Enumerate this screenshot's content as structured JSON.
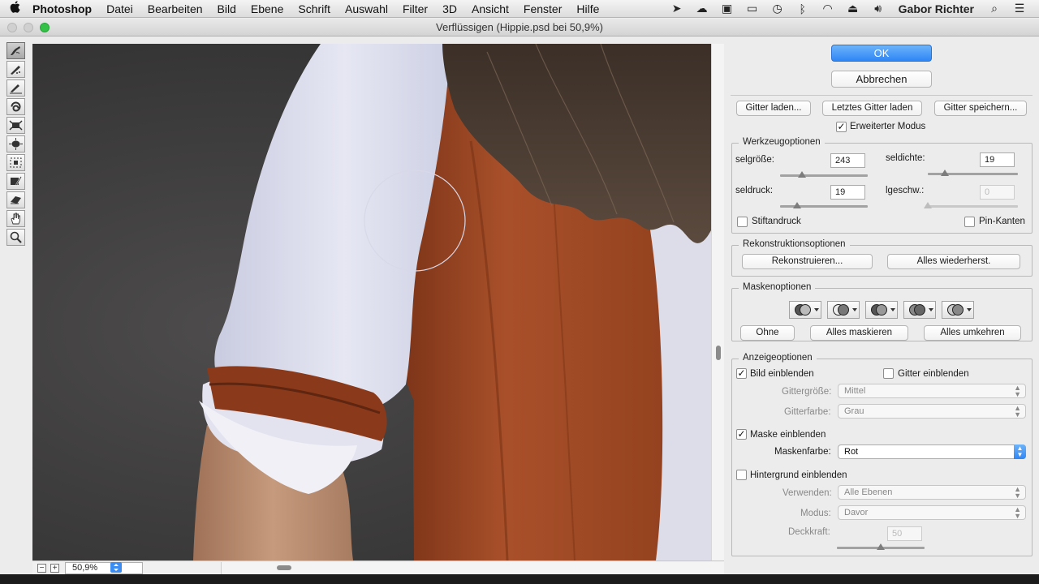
{
  "menubar": {
    "apple_icon": "apple-icon",
    "app_name": "Photoshop",
    "items": [
      "Datei",
      "Bearbeiten",
      "Bild",
      "Ebene",
      "Schrift",
      "Auswahl",
      "Filter",
      "3D",
      "Ansicht",
      "Fenster",
      "Hilfe"
    ],
    "user": "Gabor Richter",
    "status_icons": [
      "airmail-icon",
      "cloud-icon",
      "screenshot-icon",
      "airplay-icon",
      "time-machine-icon",
      "bluetooth-icon",
      "wifi-icon",
      "eject-icon",
      "volume-icon",
      "search-icon",
      "list-icon"
    ]
  },
  "window": {
    "title": "Verflüssigen (Hippie.psd bei 50,9%)"
  },
  "toolbar": {
    "tools": [
      "forward-warp-tool-icon",
      "reconstruct-tool-icon",
      "smooth-tool-icon",
      "twirl-clockwise-tool-icon",
      "pucker-tool-icon",
      "bloat-tool-icon",
      "push-left-tool-icon",
      "freeze-mask-tool-icon",
      "thaw-mask-tool-icon",
      "hand-tool-icon",
      "zoom-tool-icon"
    ],
    "active_tool": 0
  },
  "statusbar": {
    "zoom_out": "−",
    "zoom_in": "+",
    "zoom_value": "50,9%"
  },
  "panel": {
    "ok_label": "OK",
    "cancel_label": "Abbrechen",
    "load_mesh": "Gitter laden...",
    "load_last_mesh": "Letztes Gitter laden",
    "save_mesh": "Gitter speichern...",
    "advanced_mode": {
      "label": "Erweiterter Modus",
      "checked": true
    },
    "tool_options": {
      "title": "Werkzeugoptionen",
      "brush_size": {
        "label": "selgröße:",
        "value": "243",
        "level": 0.25
      },
      "brush_density": {
        "label": "seldichte:",
        "value": "19",
        "level": 0.19
      },
      "brush_pressure": {
        "label": "seldruck:",
        "value": "19",
        "level": 0.19
      },
      "brush_rate": {
        "label": "lgeschw.:",
        "value": "0",
        "level": 0.0
      },
      "stylus_pressure": {
        "label": "Stiftandruck",
        "checked": false
      },
      "pin_edges": {
        "label": "Pin-Kanten",
        "checked": false
      }
    },
    "reconstruct_options": {
      "title": "Rekonstruktionsoptionen",
      "reconstruct": "Rekonstruieren...",
      "restore_all": "Alles wiederherst."
    },
    "mask_options": {
      "title": "Maskenoptionen",
      "mask_icons": [
        "replace-selection-icon",
        "add-to-selection-icon",
        "subtract-from-selection-icon",
        "intersect-selection-icon",
        "invert-selection-icon"
      ],
      "none": "Ohne",
      "mask_all": "Alles maskieren",
      "invert_all": "Alles umkehren"
    },
    "view_options": {
      "title": "Anzeigeoptionen",
      "show_image": {
        "label": "Bild einblenden",
        "checked": true
      },
      "show_mesh": {
        "label": "Gitter einblenden",
        "checked": false
      },
      "mesh_size": {
        "label": "Gittergröße:",
        "value": "Mittel"
      },
      "mesh_color": {
        "label": "Gitterfarbe:",
        "value": "Grau"
      },
      "show_mask": {
        "label": "Maske einblenden",
        "checked": true
      },
      "mask_color": {
        "label": "Maskenfarbe:",
        "value": "Rot"
      },
      "show_backdrop": {
        "label": "Hintergrund einblenden",
        "checked": false
      },
      "use": {
        "label": "Verwenden:",
        "value": "Alle Ebenen"
      },
      "mode": {
        "label": "Modus:",
        "value": "Davor"
      },
      "opacity": {
        "label": "Deckkraft:",
        "value": "50",
        "level": 0.5
      }
    }
  },
  "colors": {
    "accent": "#2f86f5",
    "close_light": "#d0d0d0",
    "zoom_light": "#35c148",
    "canvas_bg": "#3a3939",
    "shirt": "#d9dbec",
    "scarf": "#a34a23"
  }
}
